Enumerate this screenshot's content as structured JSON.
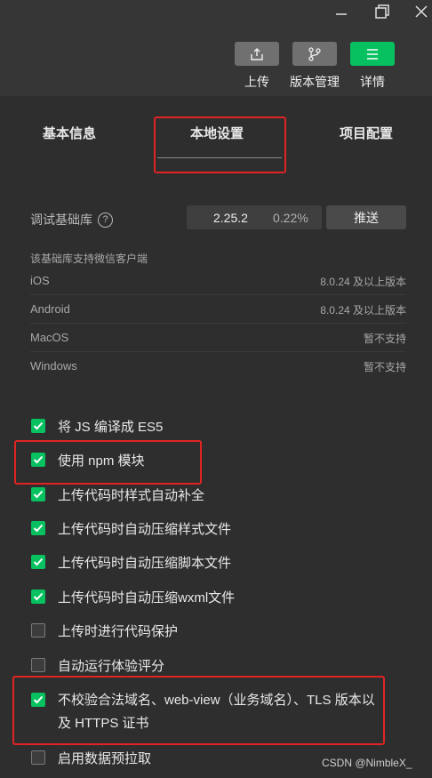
{
  "window_controls": {
    "minimize": "minimize-icon",
    "restore": "restore-icon",
    "close": "close-icon"
  },
  "toolbar": {
    "upload_label": "上传",
    "version_label": "版本管理",
    "details_label": "详情",
    "accent": "#07c160"
  },
  "tabs": {
    "basic": "基本信息",
    "local": "本地设置",
    "project": "项目配置",
    "active": "本地设置"
  },
  "debug_lib": {
    "label": "调试基础库",
    "help": "?",
    "version": "2.25.2",
    "percent": "0.22%",
    "push_label": "推送",
    "support_note": "该基础库支持微信客户端",
    "clients": [
      {
        "name": "iOS",
        "value": "8.0.24 及以上版本"
      },
      {
        "name": "Android",
        "value": "8.0.24 及以上版本"
      },
      {
        "name": "MacOS",
        "value": "暂不支持"
      },
      {
        "name": "Windows",
        "value": "暂不支持"
      }
    ]
  },
  "options": [
    {
      "label": "将 JS 编译成 ES5",
      "checked": true
    },
    {
      "label": "使用 npm 模块",
      "checked": true
    },
    {
      "label": "上传代码时样式自动补全",
      "checked": true
    },
    {
      "label": "上传代码时自动压缩样式文件",
      "checked": true
    },
    {
      "label": "上传代码时自动压缩脚本文件",
      "checked": true
    },
    {
      "label": "上传代码时自动压缩wxml文件",
      "checked": true
    },
    {
      "label": "上传时进行代码保护",
      "checked": false
    },
    {
      "label": "自动运行体验评分",
      "checked": false
    },
    {
      "label": "不校验合法域名、web-view（业务域名）、TLS 版本以及 HTTPS 证书",
      "checked": true
    },
    {
      "label": "启用数据预拉取",
      "checked": false
    }
  ],
  "watermark": "CSDN @NimbleX_"
}
